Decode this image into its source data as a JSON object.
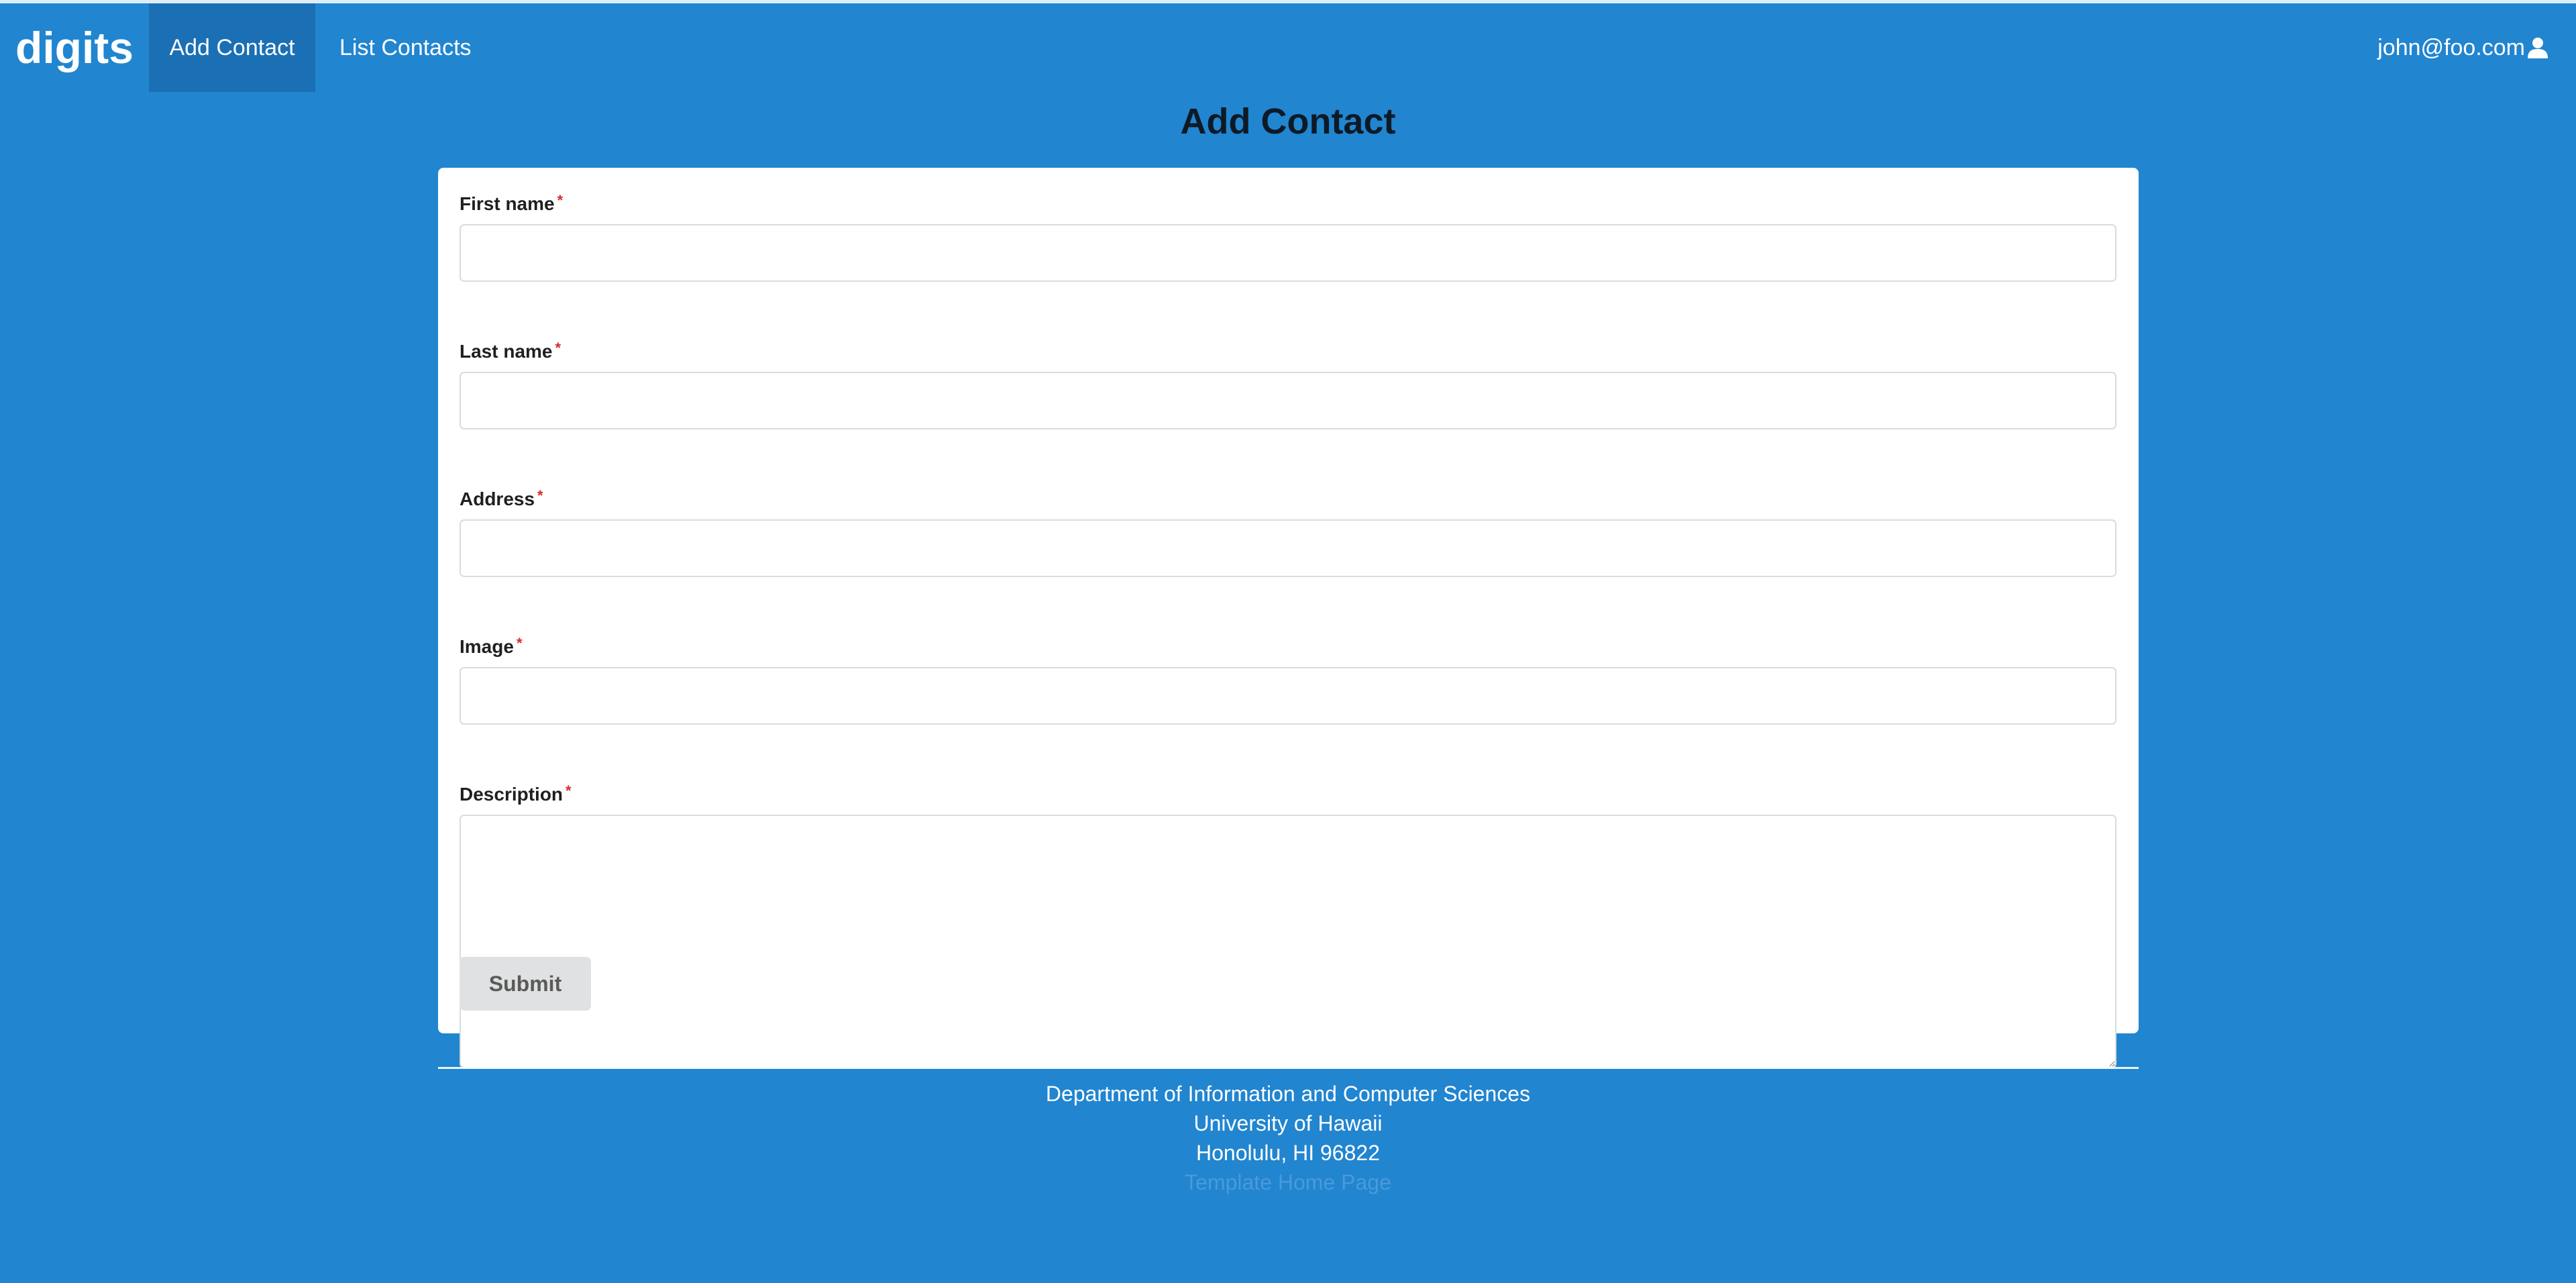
{
  "navbar": {
    "brand": "digits",
    "items": [
      {
        "label": "Add Contact",
        "active": true
      },
      {
        "label": "List Contacts",
        "active": false
      }
    ],
    "user": "john@foo.com",
    "user_icon": "user-icon"
  },
  "page": {
    "title": "Add Contact"
  },
  "form": {
    "fields": [
      {
        "label": "First name",
        "required": "*",
        "value": ""
      },
      {
        "label": "Last name",
        "required": "*",
        "value": ""
      },
      {
        "label": "Address",
        "required": "*",
        "value": ""
      },
      {
        "label": "Image",
        "required": "*",
        "value": ""
      },
      {
        "label": "Description",
        "required": "*",
        "value": ""
      }
    ],
    "submit_label": "Submit"
  },
  "footer": {
    "line1": "Department of Information and Computer Sciences",
    "line2": "University of Hawaii",
    "line3": "Honolulu, HI 96822",
    "link": "Template Home Page"
  },
  "colors": {
    "background": "#2185d0",
    "active_nav": "#1a6fb5",
    "required": "#db2828",
    "submit_bg": "#e0e1e2"
  }
}
